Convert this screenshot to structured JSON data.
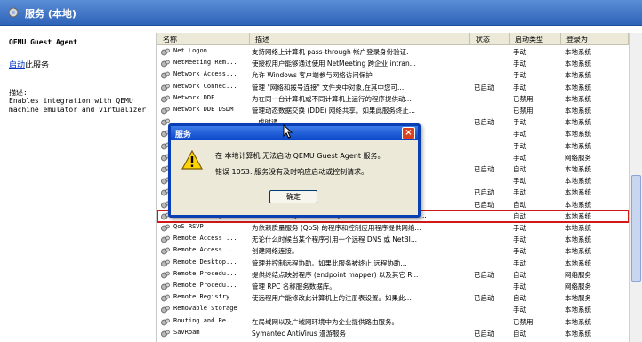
{
  "window": {
    "title": "服务 (本地)"
  },
  "left_panel": {
    "service_name": "QEMU Guest Agent",
    "start_link": "启动",
    "start_suffix": "此服务",
    "desc_label": "描述:",
    "desc_text": "Enables integration with QEMU\nmachine emulator and virtualizer."
  },
  "columns": [
    "名称",
    "描述",
    "状态",
    "启动类型",
    "登录为"
  ],
  "rows": [
    {
      "name": "Net Logon",
      "desc": "支持网络上计算机 pass-through 帐户登录身份验证.",
      "status": "",
      "startup": "手动",
      "logon": "本地系统"
    },
    {
      "name": "NetMeeting Rem...",
      "desc": "使授权用户能够通过使用 NetMeeting 跨企业 intran...",
      "status": "",
      "startup": "手动",
      "logon": "本地系统"
    },
    {
      "name": "Network Access...",
      "desc": "允许 Windows 客户端参与网络访问保护",
      "status": "",
      "startup": "手动",
      "logon": "本地系统"
    },
    {
      "name": "Network Connec...",
      "desc": "管理 \"网络和拨号连接\" 文件夹中对象,在其中您可...",
      "status": "已启动",
      "startup": "手动",
      "logon": "本地系统"
    },
    {
      "name": "Network DDE",
      "desc": "为在同一台计算机或不同计算机上运行的程序提供动...",
      "status": "",
      "startup": "已禁用",
      "logon": "本地系统"
    },
    {
      "name": "Network DDE DSDM",
      "desc": "管理动态数据交换 (DDE) 网络共享。如果此服务终止...",
      "status": "",
      "startup": "已禁用",
      "logon": "本地系统"
    },
    {
      "name": "",
      "desc": "...成时通...",
      "status": "已启动",
      "startup": "手动",
      "logon": "本地系统"
    },
    {
      "name": "",
      "desc": "",
      "status": "",
      "startup": "手动",
      "logon": "本地系统"
    },
    {
      "name": "",
      "desc": "...调用 (RPC)...",
      "status": "",
      "startup": "手动",
      "logon": "本地系统"
    },
    {
      "name": "",
      "desc": "...数据的...",
      "status": "",
      "startup": "手动",
      "logon": "网络服务"
    },
    {
      "name": "",
      "desc": "...驱动程序...",
      "status": "已启动",
      "startup": "自动",
      "logon": "本地系统"
    },
    {
      "name": "",
      "desc": "...able med...",
      "status": "",
      "startup": "手动",
      "logon": "本地系统"
    },
    {
      "name": "",
      "desc": "",
      "status": "已启动",
      "startup": "手动",
      "logon": "本地系统"
    },
    {
      "name": "",
      "desc": "",
      "status": "已启动",
      "startup": "自动",
      "logon": "本地系统"
    },
    {
      "name": "QEMU Guest Agent",
      "desc": "Enables integration with QEMU machine emulator ...",
      "status": "",
      "startup": "自动",
      "logon": "本地系统",
      "selected": true
    },
    {
      "name": "QoS RSVP",
      "desc": "为依赖质量服务 (QoS) 的程序和控制应用程序提供网络...",
      "status": "",
      "startup": "手动",
      "logon": "本地系统"
    },
    {
      "name": "Remote Access ...",
      "desc": "无论什么时候当某个程序引用一个远程 DNS 或 NetBI...",
      "status": "",
      "startup": "手动",
      "logon": "本地系统"
    },
    {
      "name": "Remote Access ...",
      "desc": "创建网络连接。",
      "status": "",
      "startup": "手动",
      "logon": "本地系统"
    },
    {
      "name": "Remote Desktop...",
      "desc": "管理并控制远程协助。如果此服务被终止,远程协助...",
      "status": "",
      "startup": "手动",
      "logon": "本地系统"
    },
    {
      "name": "Remote Procedu...",
      "desc": "提供终结点映射程序 (endpoint mapper) 以及其它 R...",
      "status": "已启动",
      "startup": "自动",
      "logon": "网络服务"
    },
    {
      "name": "Remote Procedu...",
      "desc": "管理 RPC 名称服务数据库。",
      "status": "",
      "startup": "手动",
      "logon": "网络服务"
    },
    {
      "name": "Remote Registry",
      "desc": "使远程用户能修改此计算机上的注册表设置。如果此...",
      "status": "已启动",
      "startup": "自动",
      "logon": "本地服务"
    },
    {
      "name": "Removable Storage",
      "desc": "",
      "status": "",
      "startup": "手动",
      "logon": "本地系统"
    },
    {
      "name": "Routing and Re...",
      "desc": "在局域网以及广域网环境中为企业提供路由服务。",
      "status": "",
      "startup": "已禁用",
      "logon": "本地系统"
    },
    {
      "name": "SavRoam",
      "desc": "Symantec AntiVirus 漫游服务",
      "status": "已启动",
      "startup": "自动",
      "logon": "本地系统"
    }
  ],
  "dialog": {
    "title": "服务",
    "close": "×",
    "line1": "在 本地计算机 无法启动 QEMU Guest Agent 服务。",
    "line2": "错误 1053: 服务没有及时响应启动或控制请求。",
    "ok": "确定"
  },
  "colors": {
    "header": "#2f63b8",
    "selection_outline": "#d11919",
    "dialog_border": "#0a3fb4"
  }
}
